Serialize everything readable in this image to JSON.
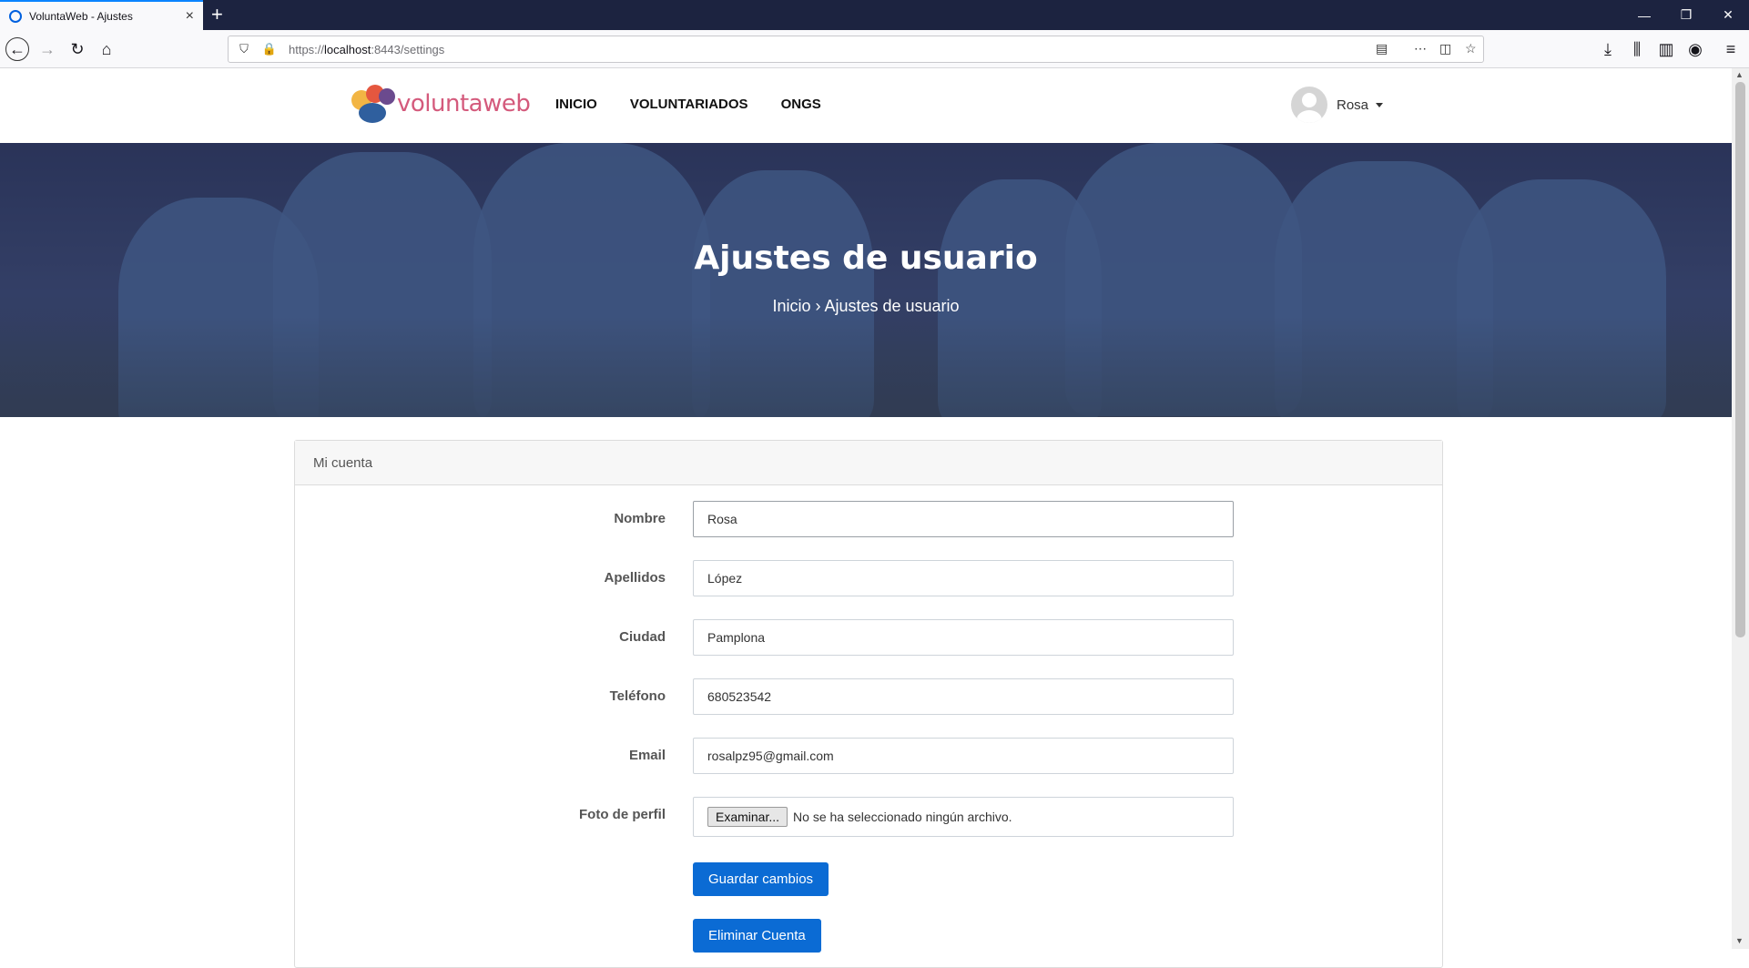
{
  "browser": {
    "tab_title": "VoluntaWeb - Ajustes",
    "new_tab": "+",
    "url_prefix": "https://",
    "url_host": "localhost",
    "url_rest": ":8443/settings",
    "window_controls": {
      "minimize": "—",
      "restore": "❐",
      "close": "✕"
    }
  },
  "site": {
    "logo_text": "voluntaweb",
    "menu": [
      "INICIO",
      "VOLUNTARIADOS",
      "ONGS"
    ],
    "user_name": "Rosa"
  },
  "hero": {
    "title": "Ajustes de usuario",
    "breadcrumb": "Inicio › Ajustes de usuario"
  },
  "card": {
    "title": "Mi cuenta",
    "fields": [
      {
        "label": "Nombre",
        "value": "Rosa"
      },
      {
        "label": "Apellidos",
        "value": "López"
      },
      {
        "label": "Ciudad",
        "value": "Pamplona"
      },
      {
        "label": "Teléfono",
        "value": "680523542"
      },
      {
        "label": "Email",
        "value": "rosalpz95@gmail.com"
      }
    ],
    "photo": {
      "label": "Foto de perfil",
      "button": "Examinar...",
      "status": "No se ha seleccionado ningún archivo."
    },
    "save_button": "Guardar cambios",
    "delete_button": "Eliminar Cuenta"
  },
  "colors": {
    "primary_button": "#0b6bd4",
    "logo_text": "#d45a7c",
    "titlebar": "#1c2340"
  }
}
